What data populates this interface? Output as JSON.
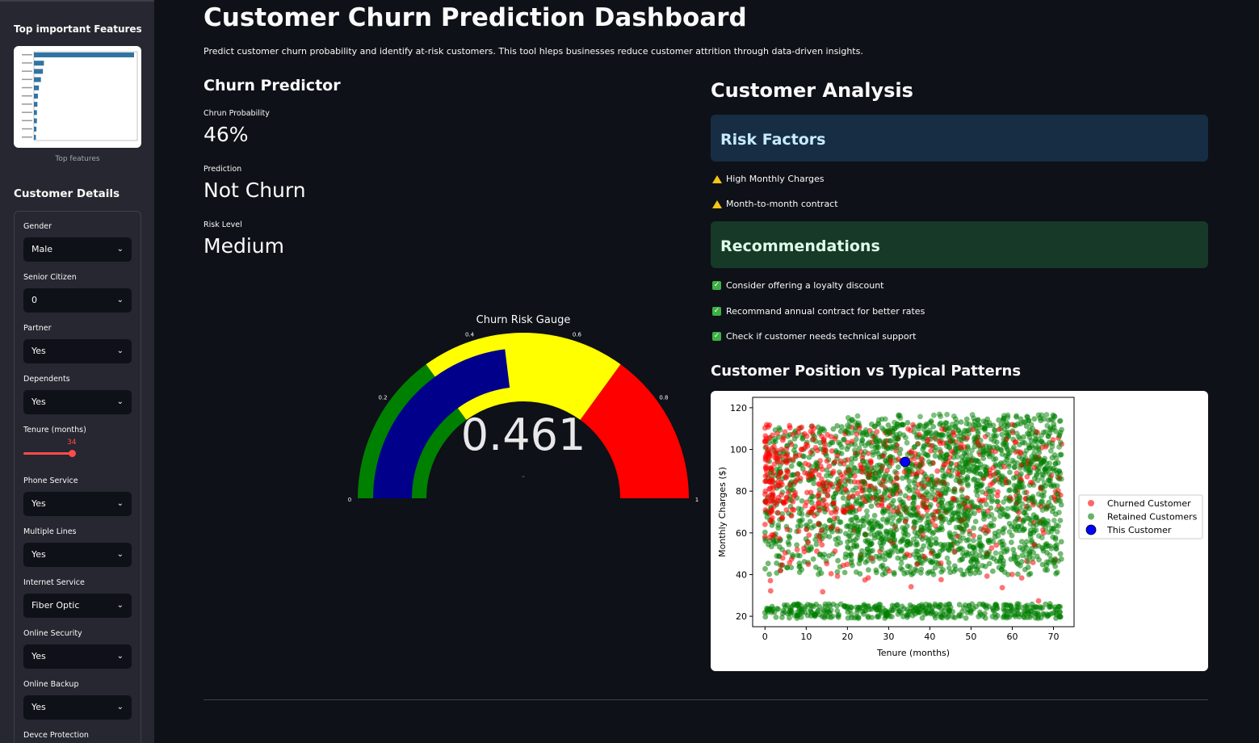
{
  "sidebar": {
    "features_heading": "Top important Features",
    "features_caption": "Top features",
    "details_heading": "Customer Details",
    "fields": [
      {
        "label": "Gender",
        "value": "Male"
      },
      {
        "label": "Senior Citizen",
        "value": "0"
      },
      {
        "label": "Partner",
        "value": "Yes"
      },
      {
        "label": "Dependents",
        "value": "Yes"
      },
      {
        "label": "Tenure (months)",
        "value": "34"
      },
      {
        "label": "Phone Service",
        "value": "Yes"
      },
      {
        "label": "Multiple Lines",
        "value": "Yes"
      },
      {
        "label": "Internet Service",
        "value": "Fiber Optic"
      },
      {
        "label": "Online Security",
        "value": "Yes"
      },
      {
        "label": "Online Backup",
        "value": "Yes"
      },
      {
        "label": "Devce Protection",
        "value": ""
      }
    ],
    "feature_importance_bars": [
      1.0,
      0.1,
      0.09,
      0.07,
      0.05,
      0.04,
      0.035,
      0.03,
      0.03,
      0.025,
      0.02
    ]
  },
  "header": {
    "title": "Customer Churn Prediction Dashboard",
    "subtitle": "Predict customer churn probability and identify at-risk customers. This tool hleps businesses reduce customer attrition through data-driven insights."
  },
  "predictor": {
    "heading": "Churn Predictor",
    "metrics": [
      {
        "label": "Chrun Probability",
        "value": "46%"
      },
      {
        "label": "Prediction",
        "value": "Not Churn"
      },
      {
        "label": "Risk Level",
        "value": "Medium"
      }
    ]
  },
  "gauge": {
    "title": "Churn Risk Gauge",
    "value": 0.461,
    "value_text": "0.461",
    "delta_text": "-",
    "ticks": [
      "0",
      "0.2",
      "0.4",
      "0.6",
      "0.8",
      "1"
    ],
    "ranges": [
      {
        "from": 0,
        "to": 0.3,
        "color": "#008000"
      },
      {
        "from": 0.3,
        "to": 0.7,
        "color": "#ffff00"
      },
      {
        "from": 0.7,
        "to": 1,
        "color": "#ff0000"
      }
    ],
    "bar_color": "#00008b"
  },
  "analysis": {
    "heading": "Customer Analysis",
    "risk_heading": "Risk Factors",
    "risk_factors": [
      "High Monthly Charges",
      "Month-to-month contract"
    ],
    "rec_heading": "Recommendations",
    "recommendations": [
      "Consider offering a loyalty discount",
      "Recommand annual contract for better rates",
      "Check if customer needs technical support"
    ],
    "scatter_heading": "Customer Position vs Typical Patterns"
  },
  "chart_data": {
    "type": "scatter",
    "xlabel": "Tenure (months)",
    "ylabel": "Monthly Charges ($)",
    "xlim": [
      -3,
      75
    ],
    "ylim": [
      15,
      125
    ],
    "xticks": [
      0,
      10,
      20,
      30,
      40,
      50,
      60,
      70
    ],
    "yticks": [
      20,
      40,
      60,
      80,
      100,
      120
    ],
    "legend_position": "right",
    "series": [
      {
        "name": "Churned Customer",
        "color": "#ff0000",
        "sample": [
          [
            1,
            95
          ],
          [
            2,
            85
          ],
          [
            3,
            75
          ],
          [
            5,
            90
          ],
          [
            8,
            100
          ],
          [
            12,
            95
          ],
          [
            15,
            80
          ],
          [
            20,
            92
          ],
          [
            25,
            88
          ],
          [
            30,
            102
          ],
          [
            35,
            98
          ],
          [
            40,
            90
          ],
          [
            45,
            85
          ],
          [
            50,
            95
          ],
          [
            55,
            100
          ],
          [
            60,
            105
          ],
          [
            65,
            110
          ],
          [
            70,
            112
          ],
          [
            2,
            45
          ],
          [
            4,
            55
          ],
          [
            10,
            65
          ],
          [
            18,
            70
          ],
          [
            28,
            80
          ],
          [
            3,
            30
          ],
          [
            6,
            40
          ]
        ]
      },
      {
        "name": "Retained Customers",
        "color": "#008000",
        "sample": [
          [
            0,
            20
          ],
          [
            10,
            20
          ],
          [
            20,
            20
          ],
          [
            30,
            20
          ],
          [
            40,
            20
          ],
          [
            50,
            20
          ],
          [
            60,
            20
          ],
          [
            70,
            20
          ],
          [
            5,
            25
          ],
          [
            15,
            25
          ],
          [
            25,
            25
          ],
          [
            35,
            25
          ],
          [
            45,
            25
          ],
          [
            55,
            25
          ],
          [
            65,
            25
          ],
          [
            10,
            50
          ],
          [
            20,
            60
          ],
          [
            30,
            70
          ],
          [
            40,
            80
          ],
          [
            50,
            90
          ],
          [
            60,
            100
          ],
          [
            70,
            110
          ],
          [
            72,
            118
          ],
          [
            65,
            115
          ],
          [
            55,
            105
          ],
          [
            45,
            95
          ],
          [
            35,
            85
          ],
          [
            25,
            75
          ],
          [
            15,
            65
          ],
          [
            5,
            55
          ],
          [
            68,
            60
          ],
          [
            58,
            50
          ],
          [
            48,
            40
          ],
          [
            38,
            45
          ],
          [
            28,
            55
          ],
          [
            62,
            80
          ],
          [
            52,
            70
          ],
          [
            42,
            60
          ],
          [
            32,
            50
          ],
          [
            22,
            40
          ]
        ]
      },
      {
        "name": "This Customer",
        "color": "#0000ff",
        "points": [
          [
            34,
            94
          ]
        ]
      }
    ]
  }
}
